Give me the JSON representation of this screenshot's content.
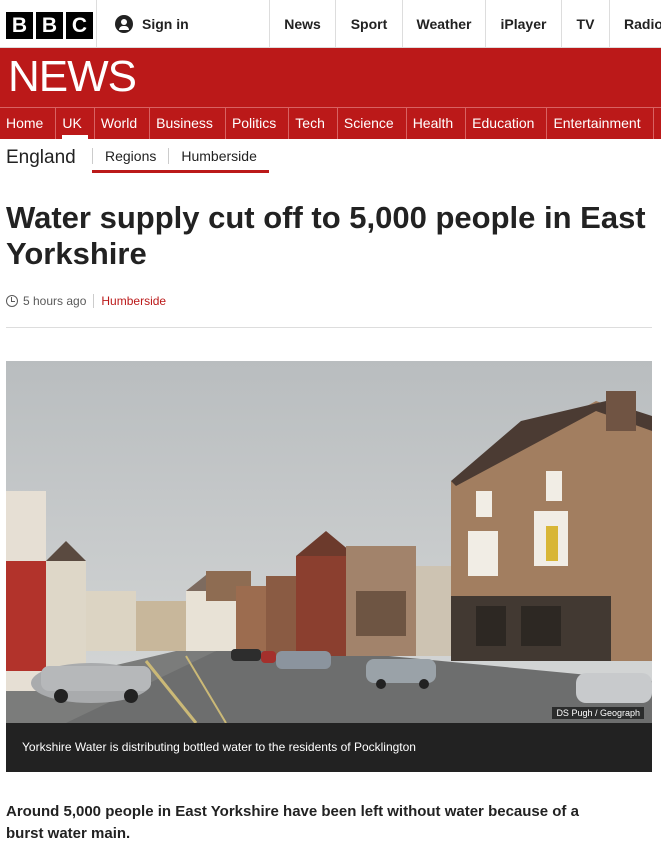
{
  "masthead": {
    "logo_letters": [
      "B",
      "B",
      "C"
    ],
    "signin_label": "Sign in",
    "nav": [
      "News",
      "Sport",
      "Weather",
      "iPlayer",
      "TV",
      "Radio"
    ]
  },
  "news_header": {
    "logo_text": "NEWS",
    "sections": [
      "Home",
      "UK",
      "World",
      "Business",
      "Politics",
      "Tech",
      "Science",
      "Health",
      "Education",
      "Entertainment"
    ],
    "active_section": "UK"
  },
  "subnav": {
    "region": "England",
    "links": [
      "Regions",
      "Humberside"
    ]
  },
  "article": {
    "headline": "Water supply cut off to 5,000 people in East Yorkshire",
    "timestamp": "5 hours ago",
    "tag": "Humberside",
    "image_credit": "DS Pugh / Geograph",
    "caption": "Yorkshire Water is distributing bottled water to the residents of Pocklington",
    "intro": "Around 5,000 people in East Yorkshire have been left without water because of a burst water main."
  },
  "colors": {
    "brand_red": "#bb1919",
    "caption_bg": "#222222"
  }
}
